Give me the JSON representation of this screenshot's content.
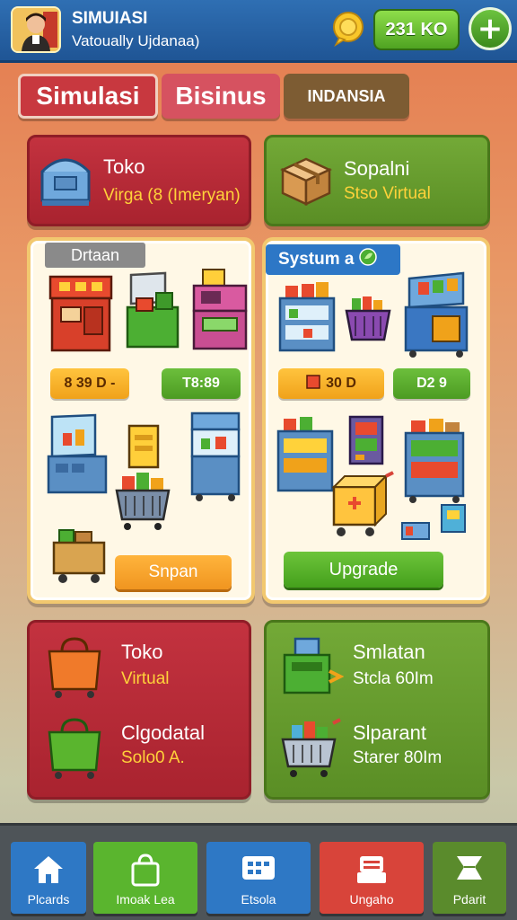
{
  "header": {
    "title": "SIMUIASI",
    "subtitle": "Vatoually Ujdanaa)",
    "money": "231 KO",
    "plus_label": "+",
    "avatar_icon": "player-avatar"
  },
  "tabs": [
    {
      "label": "Simulasi"
    },
    {
      "label": "Bisinus"
    },
    {
      "label": "INDANSIA"
    }
  ],
  "top_cards": [
    {
      "title": "Toko",
      "subtitle": "Virga (8 (Imeryan)",
      "icon": "store-box-icon",
      "color": "#b22a36"
    },
    {
      "title": "Sopalni",
      "subtitle": "Stso Virtual",
      "icon": "cardboard-box-icon",
      "color": "#66a02e"
    }
  ],
  "panels": {
    "left": {
      "label": "Drtaan",
      "price_1": "8 39 D -",
      "price_2": "T8:89",
      "button": "Snpan"
    },
    "right": {
      "label": "Systum a",
      "price_1": "30 D",
      "price_2": "D2 9",
      "button": "Upgrade"
    }
  },
  "bottom_cards": {
    "left": {
      "item1_title": "Toko",
      "item1_sub": "Virtual",
      "item2_title": "Clgodatal",
      "item2_sub": "Solo0 A."
    },
    "right": {
      "item1_title": "Smlatan",
      "item1_sub": "Stcla 60Im",
      "item2_title": "Slparant",
      "item2_sub": "Starer 80Im"
    }
  },
  "navbar": [
    {
      "label": "Plcards",
      "icon": "home-icon",
      "color": "#2e78c5"
    },
    {
      "label": "Imoak Lea",
      "icon": "shopping-bag-icon",
      "color": "#5ab52e"
    },
    {
      "label": "Etsola",
      "icon": "dashboard-icon",
      "color": "#2e78c5"
    },
    {
      "label": "Ungaho",
      "icon": "register-icon",
      "color": "#d8443a"
    },
    {
      "label": "Pdarit",
      "icon": "flag-icon",
      "color": "#5a8b2c"
    }
  ]
}
